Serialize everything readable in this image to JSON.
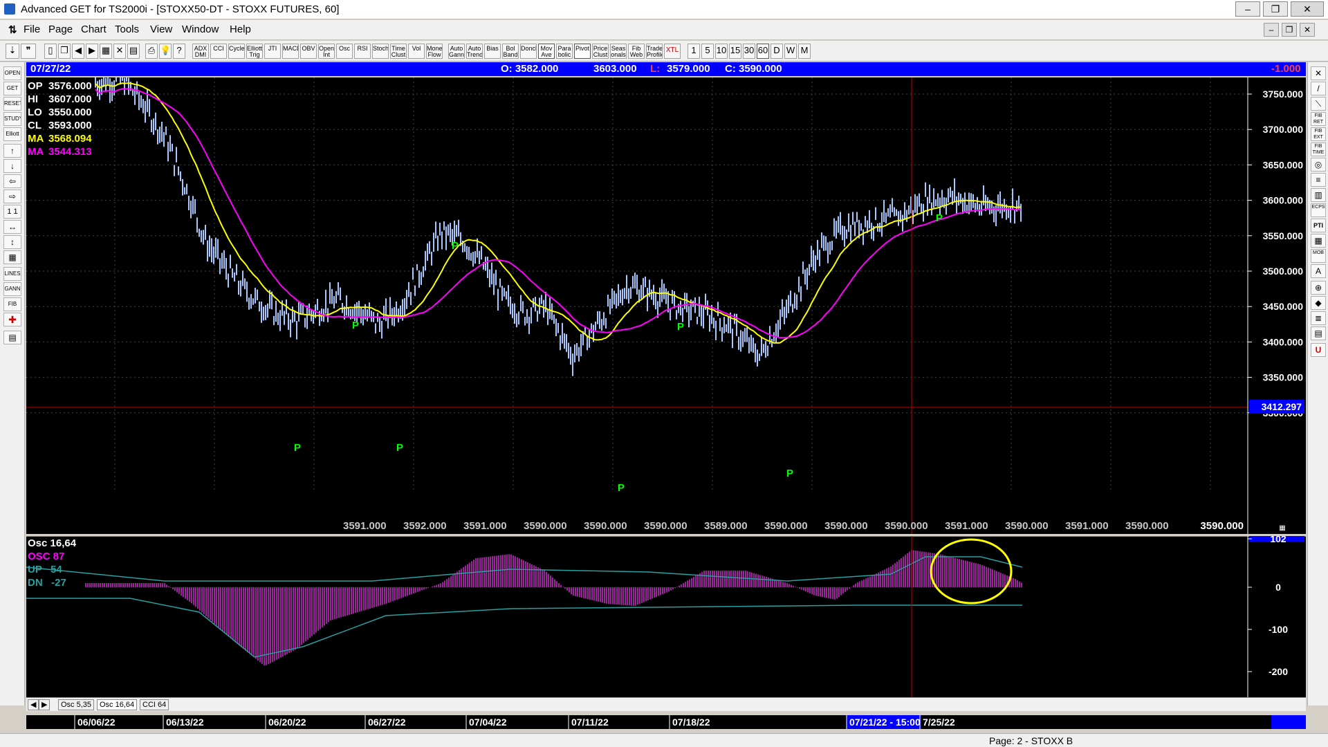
{
  "window": {
    "title": "Advanced GET for TS2000i - [STOXX50-DT - STOXX FUTURES, 60]",
    "controls": [
      "–",
      "❐",
      "✕"
    ],
    "mdi_controls": [
      "–",
      "❐",
      "✕"
    ]
  },
  "menu": [
    "File",
    "Page",
    "Chart",
    "Tools",
    "View",
    "Window",
    "Help"
  ],
  "toolbar": {
    "studies": [
      "ADX DMI",
      "CCI",
      "Cycles",
      "Elliott Trig",
      "JTI",
      "MACD",
      "OBV",
      "Open Int",
      "Osc",
      "RSI",
      "Stoch",
      "Time Clust",
      "Vol",
      "Money Flow",
      "Auto Gann",
      "Auto Trend",
      "Bias",
      "Bol Band",
      "Donch",
      "Mov Ave",
      "Para bolic",
      "Pivot",
      "Price Clust",
      "Seas onals",
      "Fib Web",
      "Trade Profile",
      "XTL"
    ],
    "timeframes": [
      "1",
      "5",
      "10",
      "15",
      "30",
      "60",
      "D",
      "W",
      "M"
    ],
    "selected_timeframe": "60"
  },
  "left_tools": [
    "OPEN",
    "GET",
    "RESET",
    "STUDY",
    "Elliott",
    "↑",
    "↓",
    "⇦",
    "⇨",
    "1 1",
    "↔",
    "↕",
    "▦",
    "LINES",
    "GANN",
    "FIB",
    "✚",
    "▤"
  ],
  "right_tools": [
    "✕",
    "/",
    "⟍",
    "FIB RET",
    "FIB EXT",
    "FIB TIME",
    "◎",
    "≡",
    "▥",
    "ECPS",
    "PTI",
    "▦",
    "MOB",
    "A",
    "⊕",
    "◆",
    "≣",
    "▤",
    "U"
  ],
  "info_bar": {
    "date": "07/27/22",
    "open": "O: 3582.000",
    "high": "3603.000",
    "low_label": "L:",
    "low": "3579.000",
    "close": "C: 3590.000",
    "change": "-1.000"
  },
  "data_window": {
    "op": {
      "label": "OP",
      "value": "3576.000"
    },
    "hi": {
      "label": "HI",
      "value": "3607.000"
    },
    "lo": {
      "label": "LO",
      "value": "3550.000"
    },
    "cl": {
      "label": "CL",
      "value": "3593.000"
    },
    "ma1": {
      "label": "MA",
      "value": "3568.094"
    },
    "ma2": {
      "label": "MA",
      "value": "3544.313"
    }
  },
  "osc_window": {
    "title": "Osc 16,64",
    "osc": "OSC 87",
    "up": "UP   54",
    "dn": "DN   -27"
  },
  "price_axis": [
    "3750.000",
    "3700.000",
    "3650.000",
    "3600.000",
    "3550.000",
    "3500.000",
    "3450.000",
    "3400.000",
    "3350.000",
    "3300.000"
  ],
  "price_cursor": "3412.297",
  "osc_axis": [
    "102",
    "0",
    "-100",
    "-200"
  ],
  "bottom_values": [
    "3591.000",
    "3592.000",
    "3591.000",
    "3590.000",
    "3590.000",
    "3590.000",
    "3589.000",
    "3590.000",
    "3590.000",
    "3590.000",
    "3591.000",
    "3590.000",
    "3591.000",
    "3590.000",
    "3590.000"
  ],
  "pivot_label": "P",
  "chart_tabs": [
    "Osc 5,35",
    "Osc 16,64",
    "CCI 64"
  ],
  "active_tab": "Osc 16,64",
  "dates": [
    "06/06/22",
    "06/13/22",
    "06/20/22",
    "06/27/22",
    "07/04/22",
    "07/11/22",
    "07/18/22",
    "07/21/22 - 15:00",
    "7/25/22"
  ],
  "status": "Page: 2 - STOXX B",
  "colors": {
    "bars": "#a8c8ff",
    "ma_yellow": "#ffff00",
    "ma_magenta": "#ff00ff",
    "pivot": "#00ff00",
    "osc": "#cc33cc",
    "band": "#2aa0a0",
    "highlight_circle": "#ffff00",
    "cursor": "#c00000"
  }
}
